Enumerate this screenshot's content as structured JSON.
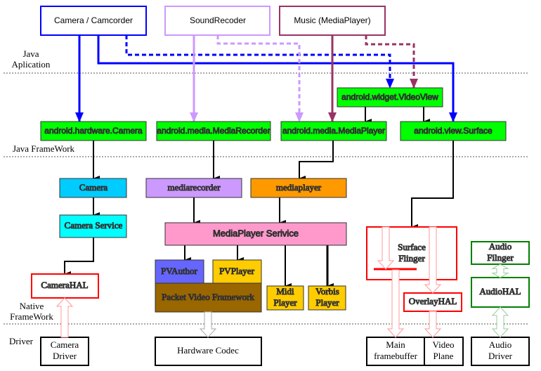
{
  "layers": {
    "java_app": [
      "Java",
      "Aplication"
    ],
    "java_framework": "Java FrameWork",
    "native_framework": [
      "Native",
      "FrameWork"
    ],
    "driver": "Driver"
  },
  "apps": {
    "camera": "Camera / Camcorder",
    "sound": "SoundRecoder",
    "music": "Music (MediaPlayer)"
  },
  "java_framework": {
    "hardware_camera": "android.hardware.Camera",
    "media_recorder": "android.media.MediaRecorder",
    "media_player": "android.media.MediaPlayer",
    "video_view": "android.widget.VideoView",
    "view_surface": "android.view.Surface"
  },
  "native": {
    "camera": "Camera",
    "mediarecorder": "mediarecorder",
    "mediaplayer": "mediaplayer",
    "camera_service": "Camera Service",
    "mediaplayer_service": "MediaPlayer  Serivice",
    "camera_hal": "CameraHAL",
    "pvauthor": "PVAuthor",
    "pvplayer": "PVPlayer",
    "packet_video": "Packet Video Framework",
    "midi_player": [
      "Midi",
      "Player"
    ],
    "vorbis_player": [
      "Vorbis",
      "Player"
    ],
    "surface_flinger": [
      "Surface",
      "Flinger"
    ],
    "overlay_hal": "OverlayHAL",
    "audio_flinger": [
      "Audio",
      "Filnger"
    ],
    "audio_hal": "AudioHAL"
  },
  "drivers": {
    "camera_driver": [
      "Camera",
      "Driver"
    ],
    "hardware_codec": "Hardware Codec",
    "main_framebuffer": [
      "Main",
      "framebuffer"
    ],
    "video_plane": [
      "Video",
      "Plane"
    ],
    "audio_driver": [
      "Audio",
      "Driver"
    ]
  },
  "colors": {
    "camera_app": "#0000ff",
    "sound_app": "#cc99ff",
    "music_app": "#993366",
    "java_framework_fill": "#00ff00",
    "camera_fill": "#00ccff",
    "camera_service_fill": "#00ffff",
    "mediarecorder_fill": "#cc99ff",
    "mediaplayer_fill": "#ff9900",
    "mediaplayer_service_fill": "#ff99cc",
    "pvauthor_fill": "#6666ff",
    "pvplayer_fill": "#ffcc00",
    "packet_video_fill": "#996600",
    "hal_red": "#ff0000",
    "audio_green": "#008000"
  }
}
